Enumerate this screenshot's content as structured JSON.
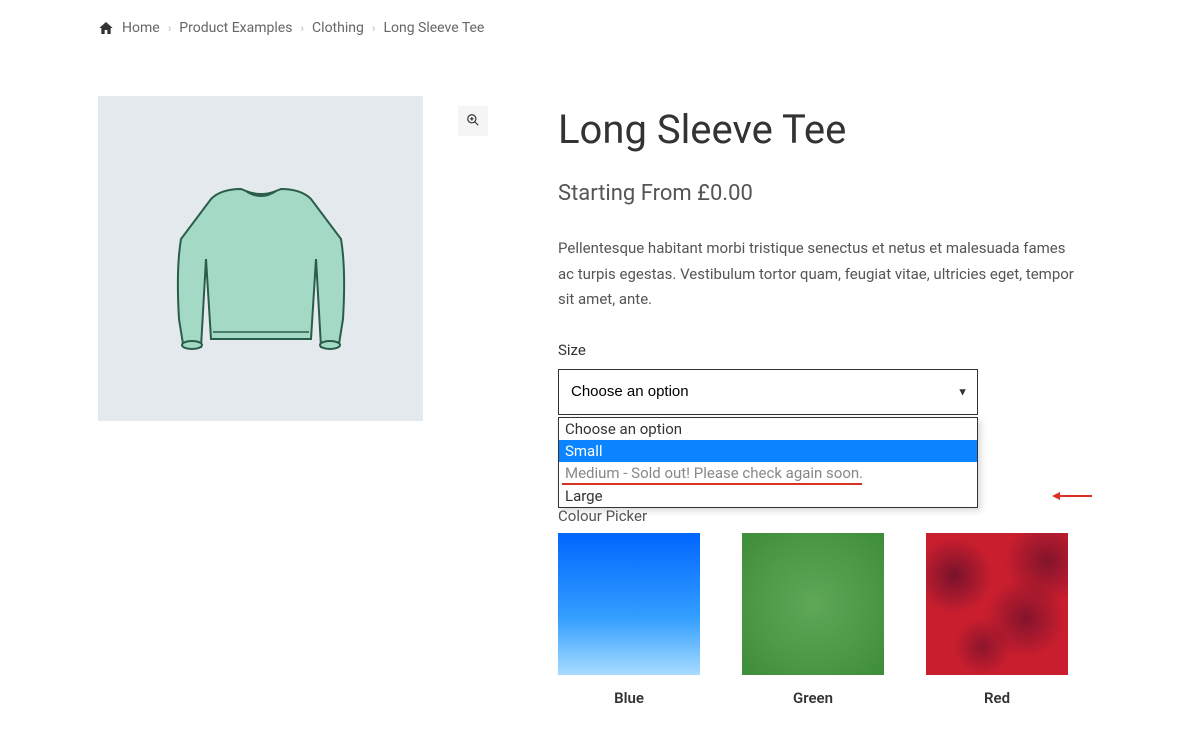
{
  "breadcrumb": {
    "items": [
      {
        "label": "Home"
      },
      {
        "label": "Product Examples"
      },
      {
        "label": "Clothing"
      },
      {
        "label": "Long Sleeve Tee"
      }
    ]
  },
  "product": {
    "title": "Long Sleeve Tee",
    "price": "Starting From £0.00",
    "description": "Pellentesque habitant morbi tristique senectus et netus et malesuada fames ac turpis egestas. Vestibulum tortor quam, feugiat vitae, ultricies eget, tempor sit amet, ante."
  },
  "size": {
    "label": "Size",
    "selected": "Choose an option",
    "options": [
      {
        "label": "Choose an option",
        "highlighted": false,
        "soldout": false
      },
      {
        "label": "Small",
        "highlighted": true,
        "soldout": false
      },
      {
        "label": "Medium - Sold out! Please check again soon.",
        "highlighted": false,
        "soldout": true
      },
      {
        "label": "Large",
        "highlighted": false,
        "soldout": false
      }
    ]
  },
  "colour": {
    "label": "Colour Picker",
    "swatches": [
      {
        "name": "Blue"
      },
      {
        "name": "Green"
      },
      {
        "name": "Red"
      }
    ]
  }
}
